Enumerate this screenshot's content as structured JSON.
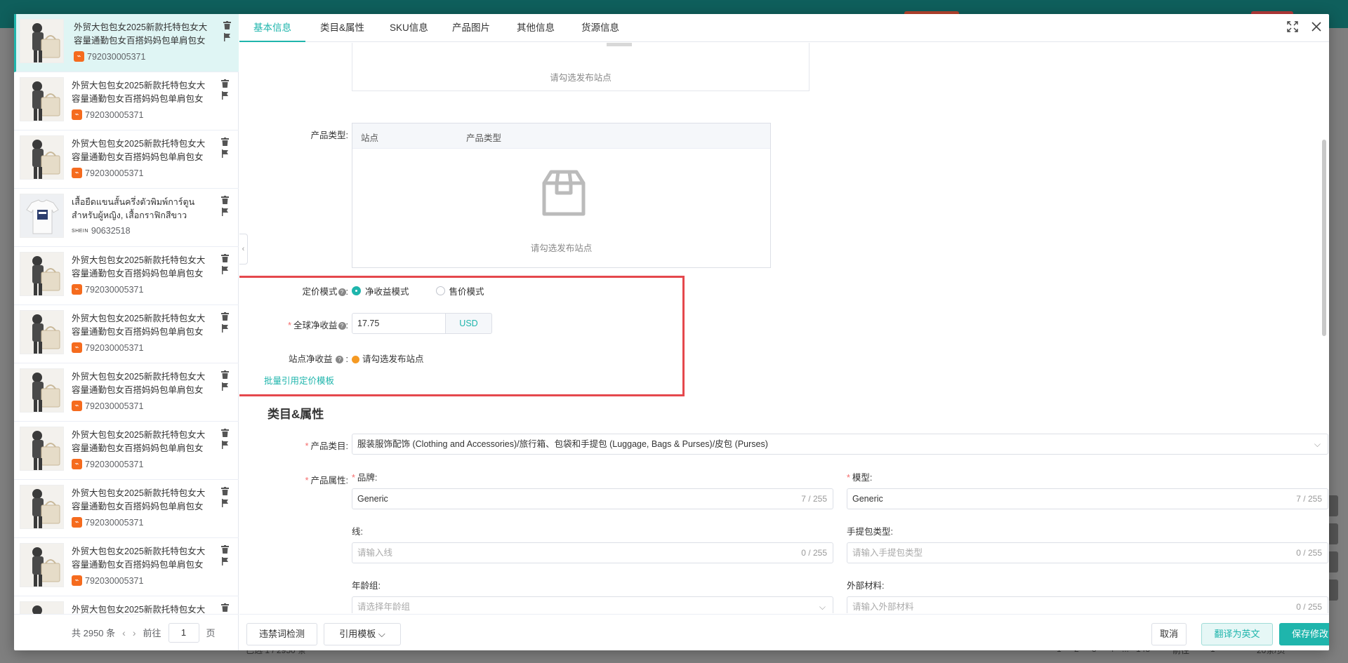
{
  "tabs": [
    {
      "label": "基本信息"
    },
    {
      "label": "类目&属性"
    },
    {
      "label": "SKU信息"
    },
    {
      "label": "产品图片"
    },
    {
      "label": "其他信息"
    },
    {
      "label": "货源信息"
    }
  ],
  "product_list": {
    "items": [
      {
        "title": "外贸大包包女2025新款托特包女大容量通勤包女百搭妈妈包单肩包女",
        "id": "792030005371",
        "source": "1688"
      },
      {
        "title": "外贸大包包女2025新款托特包女大容量通勤包女百搭妈妈包单肩包女",
        "id": "792030005371",
        "source": "1688"
      },
      {
        "title": "外贸大包包女2025新款托特包女大容量通勤包女百搭妈妈包单肩包女",
        "id": "792030005371",
        "source": "1688"
      },
      {
        "title": "เสื้อยืดแขนสั้นครึ่งตัวพิมพ์การ์ตูนสำหรับผู้หญิง, เสื้อกราฟิกสีขาว #3333",
        "id": "90632518",
        "source": "SHEIN"
      },
      {
        "title": "外贸大包包女2025新款托特包女大容量通勤包女百搭妈妈包单肩包女",
        "id": "792030005371",
        "source": "1688"
      },
      {
        "title": "外贸大包包女2025新款托特包女大容量通勤包女百搭妈妈包单肩包女",
        "id": "792030005371",
        "source": "1688"
      },
      {
        "title": "外贸大包包女2025新款托特包女大容量通勤包女百搭妈妈包单肩包女",
        "id": "792030005371",
        "source": "1688"
      },
      {
        "title": "外贸大包包女2025新款托特包女大容量通勤包女百搭妈妈包单肩包女",
        "id": "792030005371",
        "source": "1688"
      },
      {
        "title": "外贸大包包女2025新款托特包女大容量通勤包女百搭妈妈包单肩包女",
        "id": "792030005371",
        "source": "1688"
      },
      {
        "title": "外贸大包包女2025新款托特包女大容量通勤包女百搭妈妈包单肩包女",
        "id": "792030005371",
        "source": "1688"
      },
      {
        "title": "外贸大包包女2025新款托特包女大容量通勤包女百搭妈妈包单肩包女",
        "id": "",
        "source": "1688"
      }
    ],
    "pager": {
      "total": "共 2950 条",
      "goto": "前往",
      "page": "1",
      "unit": "页"
    },
    "shein_label": "SHEIN"
  },
  "basic": {
    "top_empty": "请勾选发布站点",
    "product_type_label": "产品类型:",
    "product_type_cols": [
      "站点",
      "产品类型"
    ],
    "product_type_empty": "请勾选发布站点",
    "pricing_mode_label": "定价模式",
    "pricing_mode_options": [
      "净收益模式",
      "售价模式"
    ],
    "global_profit_label": "全球净收益",
    "global_profit_value": "17.75",
    "currency": "USD",
    "site_profit_label": "站点净收益",
    "site_profit_hint": "请勾选发布站点",
    "batch_template_link": "批量引用定价模板"
  },
  "category": {
    "section_title": "类目&属性",
    "category_label": "产品类目:",
    "category_value": "服装服饰配饰 (Clothing and Accessories)/旅行箱、包袋和手提包 (Luggage, Bags & Purses)/皮包 (Purses)",
    "attrs_label": "产品属性:",
    "fields": [
      {
        "label": "品牌:",
        "required": true,
        "value": "Generic",
        "placeholder": "",
        "count": "7 / 255"
      },
      {
        "label": "模型:",
        "required": true,
        "value": "Generic",
        "placeholder": "",
        "count": "7 / 255"
      },
      {
        "label": "线:",
        "required": false,
        "value": "",
        "placeholder": "请输入线",
        "count": "0 / 255"
      },
      {
        "label": "手提包类型:",
        "required": false,
        "value": "",
        "placeholder": "请输入手提包类型",
        "count": "0 / 255"
      },
      {
        "label": "年龄组:",
        "required": false,
        "value": "",
        "placeholder": "请选择年龄组",
        "count": ""
      },
      {
        "label": "外部材料:",
        "required": false,
        "value": "",
        "placeholder": "请输入外部材料",
        "count": "0 / 255"
      }
    ]
  },
  "footer_buttons": {
    "check": "违禁词检测",
    "template": "引用模板",
    "cancel": "取消",
    "translate": "翻译为英文",
    "save": "保存修改"
  },
  "background": {
    "footer_text": "已选 1 / 2950 条",
    "pages": [
      "1",
      "2",
      "3",
      "4",
      "...",
      "148"
    ],
    "goto": "前往",
    "goto_page": "1",
    "per_page": "20条/页"
  },
  "colors": {
    "accent": "#1fb5ac",
    "highlight": "#e5484d"
  }
}
